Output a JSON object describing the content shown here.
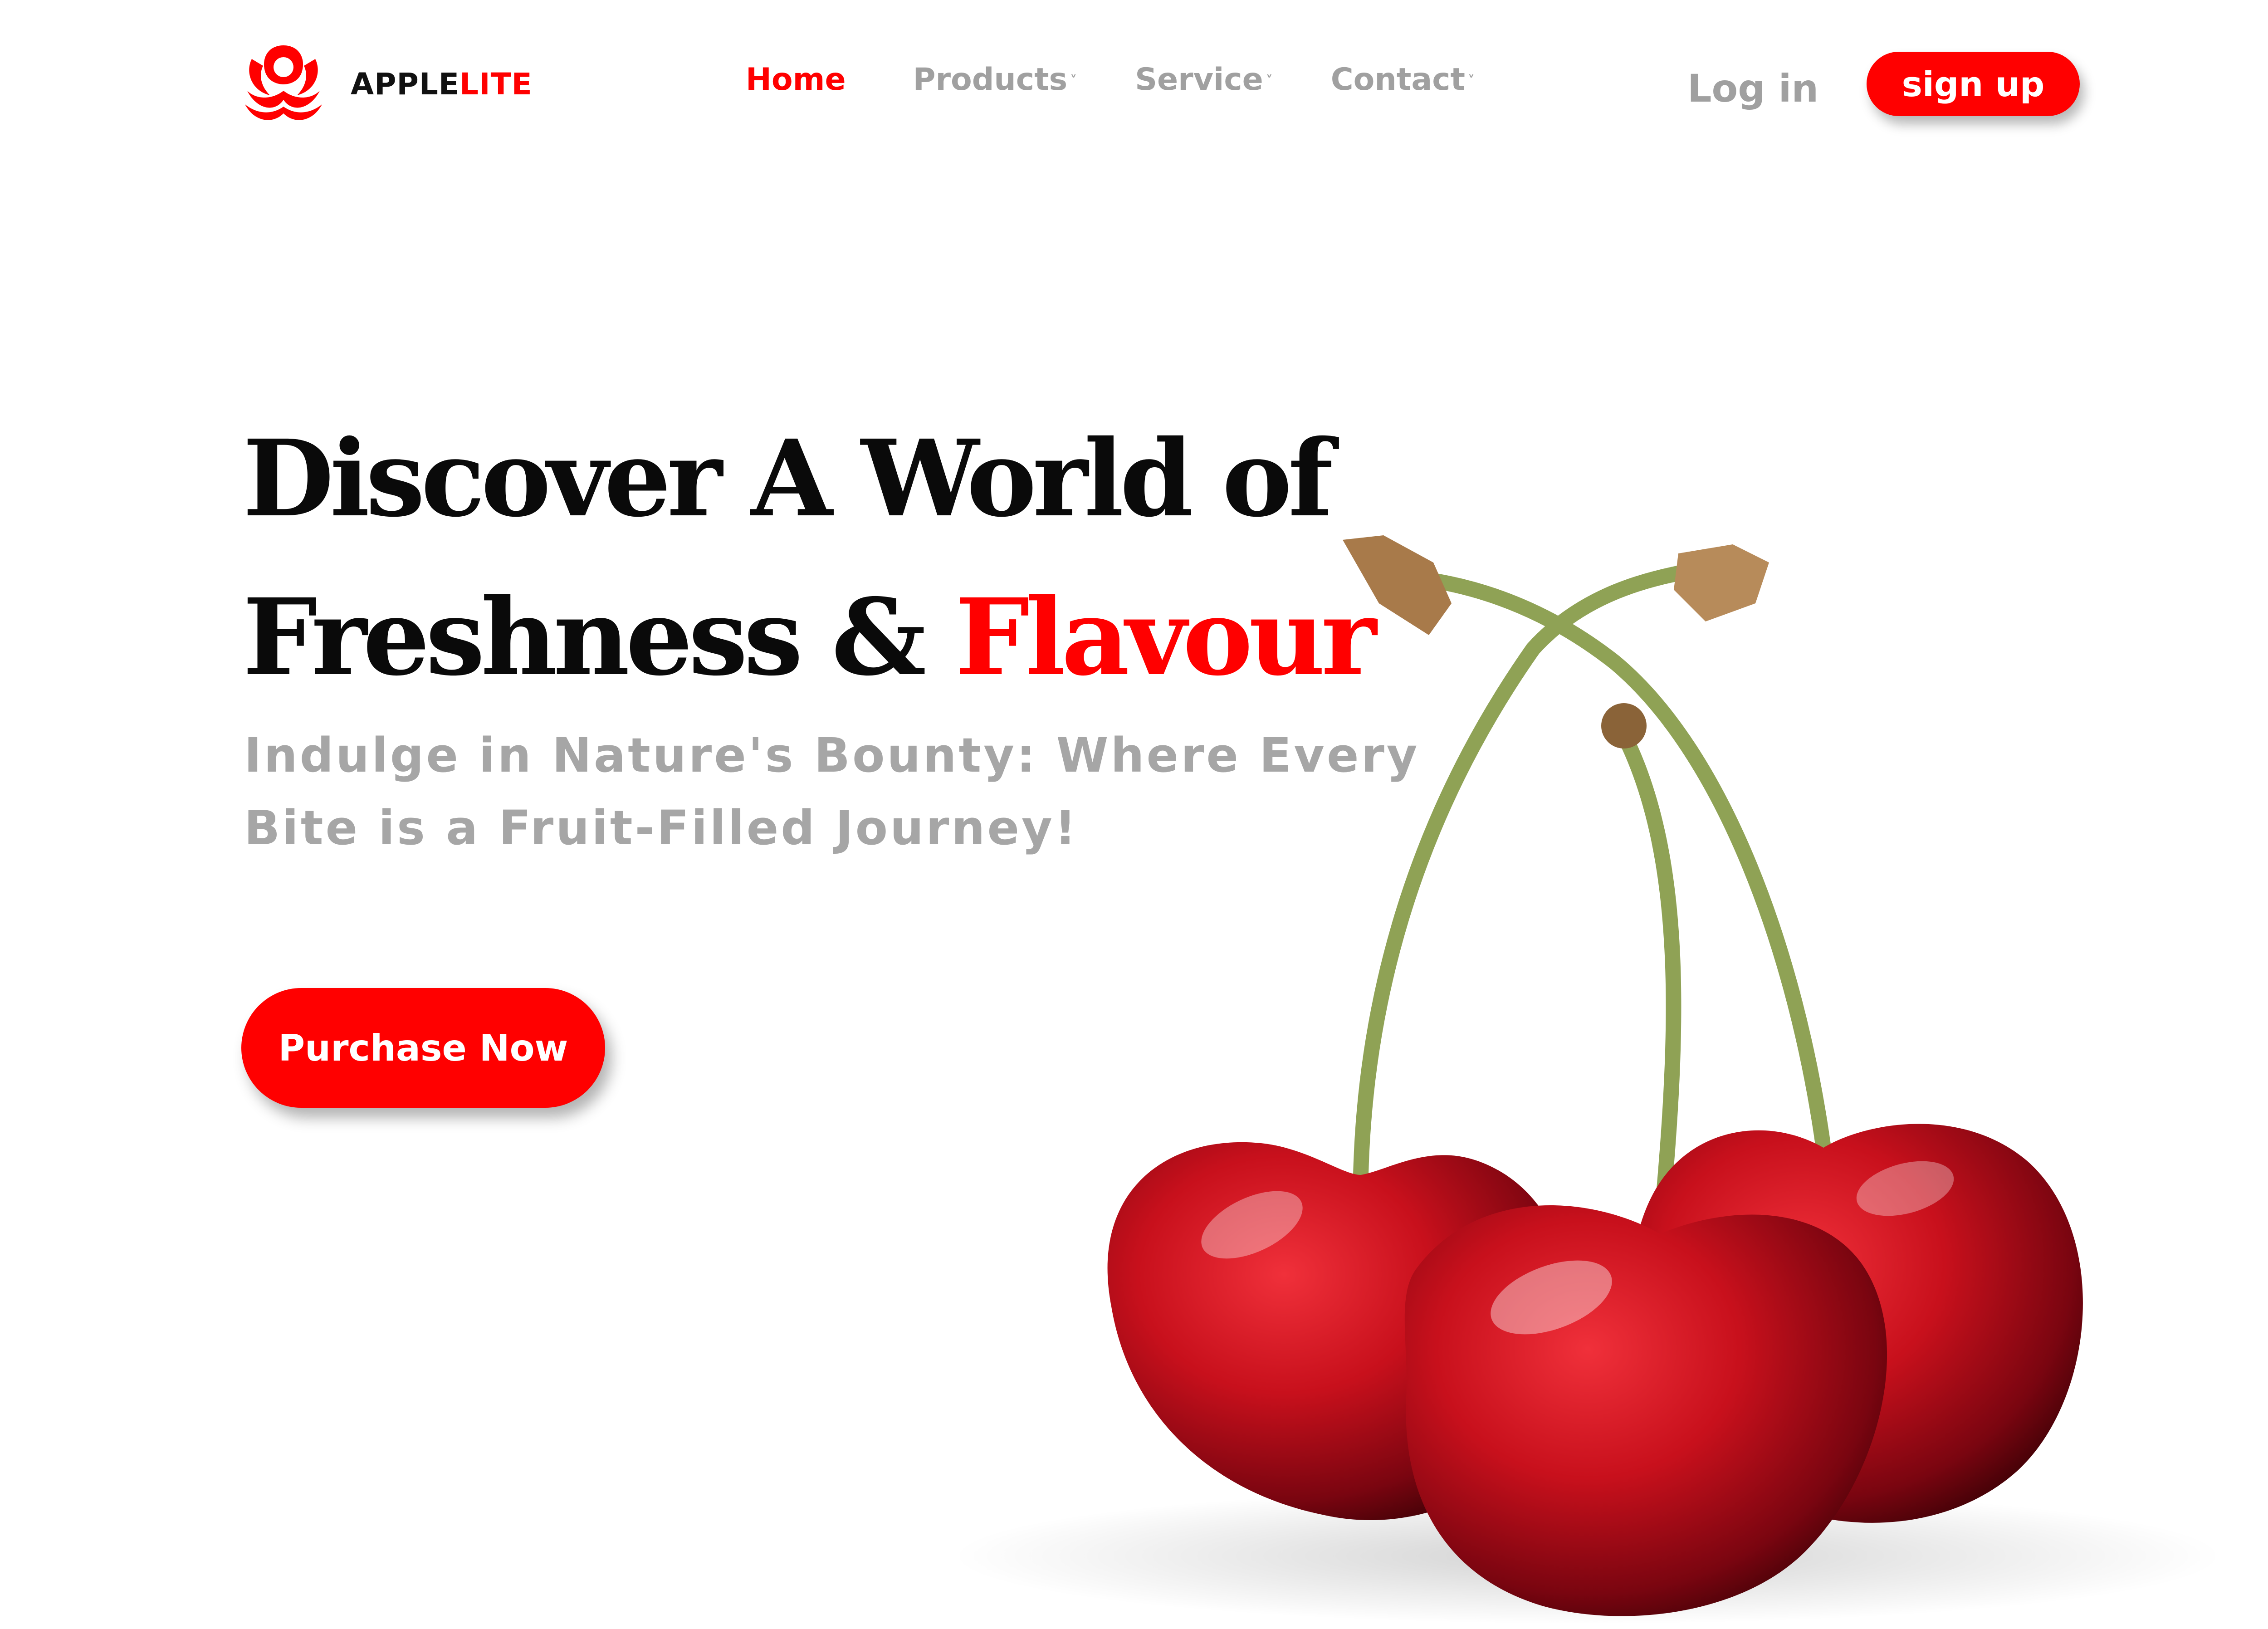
{
  "brand": {
    "name_part1": "APPLE",
    "name_part2": "LITE",
    "logo_icon": "apple-lotus-logo"
  },
  "nav": {
    "items": [
      {
        "label": "Home",
        "active": true,
        "has_dropdown": false
      },
      {
        "label": "Products",
        "active": false,
        "has_dropdown": true
      },
      {
        "label": "Service",
        "active": false,
        "has_dropdown": true
      },
      {
        "label": "Contact",
        "active": false,
        "has_dropdown": true
      }
    ],
    "dropdown_glyph": "˅"
  },
  "auth": {
    "login_label": "Log in",
    "signup_label": "sign up"
  },
  "hero": {
    "title_line1": "Discover A World of",
    "title_line2_part1": "Freshness & ",
    "title_line2_accent": "Flavour",
    "subtitle_line1": "Indulge in Nature's Bounty: Where Every",
    "subtitle_line2": "Bite is a Fruit-Filled Journey!",
    "cta_label": "Purchase Now"
  },
  "colors": {
    "accent": "#ff0000",
    "muted": "#a0a0a0",
    "text": "#0a0a0a",
    "background": "#ffffff"
  }
}
